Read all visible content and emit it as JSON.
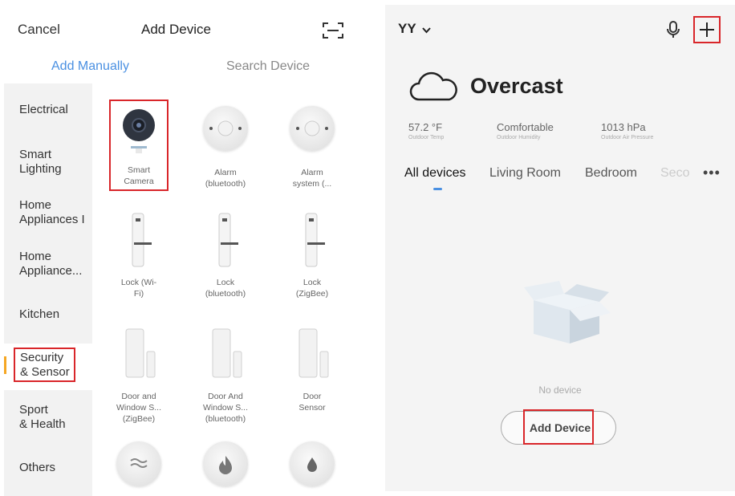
{
  "left": {
    "cancel": "Cancel",
    "title": "Add Device",
    "tabs": {
      "manual": "Add Manually",
      "search": "Search Device"
    },
    "categories": [
      {
        "line1": "Electrical",
        "line2": ""
      },
      {
        "line1": "Smart",
        "line2": "Lighting"
      },
      {
        "line1": "Home",
        "line2": "Appliances I"
      },
      {
        "line1": "Home",
        "line2": "Appliance..."
      },
      {
        "line1": "Kitchen",
        "line2": ""
      },
      {
        "line1": "Security",
        "line2": "& Sensor"
      },
      {
        "line1": "Sport",
        "line2": "& Health"
      },
      {
        "line1": "Others",
        "line2": ""
      }
    ],
    "devices": [
      {
        "line1": "Smart",
        "line2": "Camera",
        "line3": "",
        "icon": "camera-icon"
      },
      {
        "line1": "Alarm",
        "line2": "(bluetooth)",
        "line3": "",
        "icon": "alarm-icon"
      },
      {
        "line1": "Alarm",
        "line2": "system (...",
        "line3": "",
        "icon": "alarm-system-icon"
      },
      {
        "line1": "Lock (Wi-",
        "line2": "Fi)",
        "line3": "",
        "icon": "lock-icon"
      },
      {
        "line1": "Lock",
        "line2": "(bluetooth)",
        "line3": "",
        "icon": "lock-icon"
      },
      {
        "line1": "Lock",
        "line2": "(ZigBee)",
        "line3": "",
        "icon": "lock-icon"
      },
      {
        "line1": "Door and",
        "line2": "Window S...",
        "line3": "(ZigBee)",
        "icon": "door-sensor-icon"
      },
      {
        "line1": "Door And",
        "line2": "Window S...",
        "line3": "(bluetooth)",
        "icon": "door-sensor-icon"
      },
      {
        "line1": "Door",
        "line2": "Sensor",
        "line3": "",
        "icon": "door-sensor-icon"
      }
    ],
    "bottom_icons": [
      "air-sensor-icon",
      "smoke-detector-icon",
      "water-leak-icon"
    ]
  },
  "right": {
    "home_name": "YY",
    "weather": "Overcast",
    "stats": [
      {
        "value": "57.2 °F",
        "sub": "Outdoor Temp"
      },
      {
        "value": "Comfortable",
        "sub": "Outdoor Humidity"
      },
      {
        "value": "1013 hPa",
        "sub": "Outdoor Air Pressure"
      }
    ],
    "rooms": [
      "All devices",
      "Living Room",
      "Bedroom",
      "Seco"
    ],
    "more": "•••",
    "empty_text": "No device",
    "add_button": "Add Device"
  },
  "colors": {
    "accent": "#4a90e2",
    "highlight": "#d9262a",
    "indicator": "#f5a623"
  }
}
